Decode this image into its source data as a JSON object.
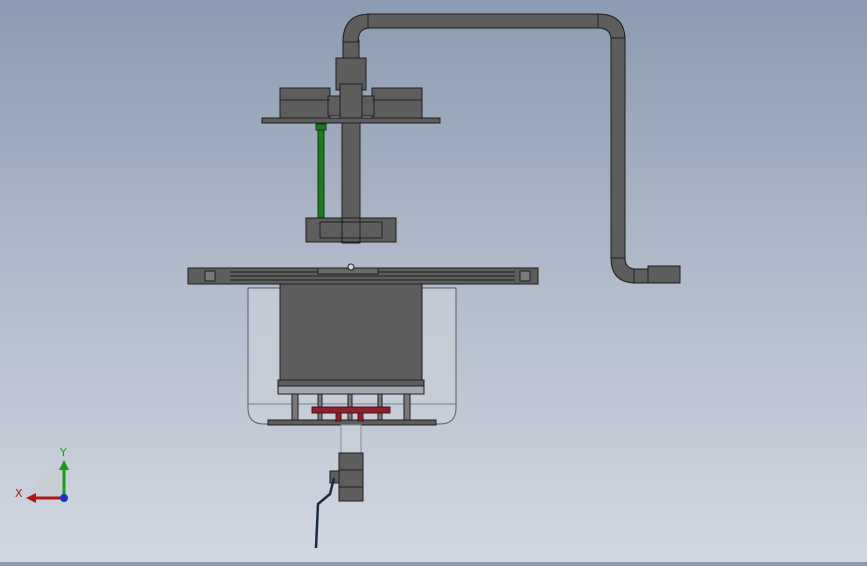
{
  "viewport": {
    "background_top": "#8c9bb2",
    "background_bottom": "#d2d8e2"
  },
  "model": {
    "part_color": "#5d5d5d",
    "edge_color": "#1e1e1e",
    "transparent_tank_color": "#c9cfd8",
    "rod_color": "#1f7a1f",
    "manifold_color": "#8c2030",
    "handle_color": "#1c2a44"
  },
  "triad": {
    "x_label": "X",
    "y_label": "Y",
    "x_color": "#b01818",
    "y_color": "#17a017",
    "z_color": "#2030c0"
  }
}
